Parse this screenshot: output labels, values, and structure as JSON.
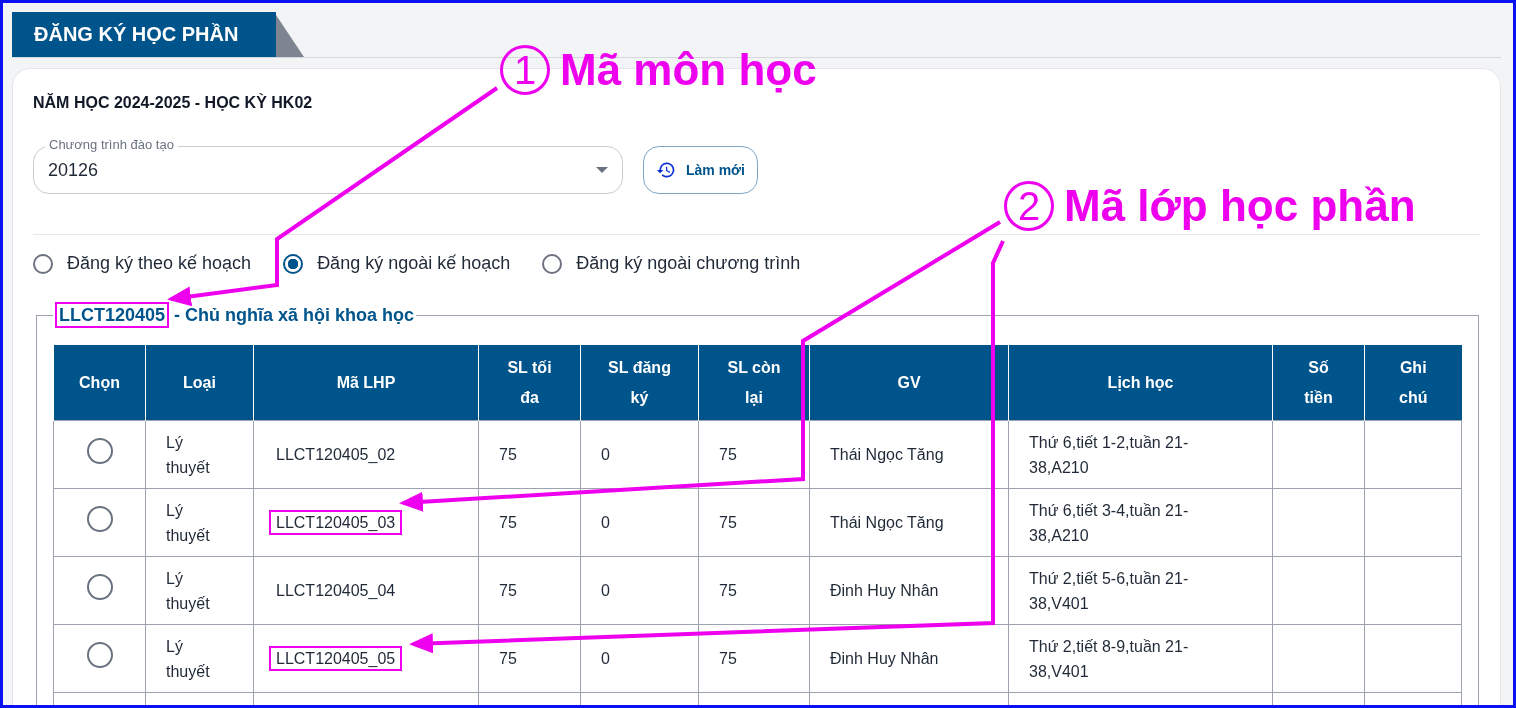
{
  "page_tab": "ĐĂNG KÝ HỌC PHẦN",
  "term_title": "NĂM HỌC 2024-2025 - HỌC KỲ HK02",
  "program_select": {
    "label": "Chương trình đào tạo",
    "value": "20126"
  },
  "refresh_button": "Làm mới",
  "registration_modes": [
    {
      "label": "Đăng ký theo kế hoạch",
      "selected": false
    },
    {
      "label": "Đăng ký ngoài kế hoạch",
      "selected": true
    },
    {
      "label": "Đăng ký ngoài chương trình",
      "selected": false
    }
  ],
  "course": {
    "code": "LLCT120405",
    "highlighted": true,
    "name": "- Chủ nghĩa xã hội khoa học"
  },
  "table": {
    "columns": [
      "Chọn",
      "Loại",
      "Mã LHP",
      "SL tối đa",
      "SL đăng ký",
      "SL còn lại",
      "GV",
      "Lịch học",
      "Số tiền",
      "Ghi chú"
    ],
    "rows": [
      {
        "selected": false,
        "type": "Lý thuyết",
        "class_code": "LLCT120405_02",
        "highlighted": false,
        "max": "75",
        "registered": "0",
        "remaining": "75",
        "lecturer": "Thái Ngọc Tăng",
        "schedule": "Thứ 6,tiết 1-2,tuần 21-38,A210"
      },
      {
        "selected": false,
        "type": "Lý thuyết",
        "class_code": "LLCT120405_03",
        "highlighted": true,
        "max": "75",
        "registered": "0",
        "remaining": "75",
        "lecturer": "Thái Ngọc Tăng",
        "schedule": "Thứ 6,tiết 3-4,tuần 21-38,A210"
      },
      {
        "selected": false,
        "type": "Lý thuyết",
        "class_code": "LLCT120405_04",
        "highlighted": false,
        "max": "75",
        "registered": "0",
        "remaining": "75",
        "lecturer": "Đinh Huy Nhân",
        "schedule": "Thứ 2,tiết 5-6,tuần 21-38,V401"
      },
      {
        "selected": false,
        "type": "Lý thuyết",
        "class_code": "LLCT120405_05",
        "highlighted": true,
        "max": "75",
        "registered": "0",
        "remaining": "75",
        "lecturer": "Đinh Huy Nhân",
        "schedule": "Thứ 2,tiết 8-9,tuần 21-38,V401"
      }
    ]
  },
  "annotations": [
    {
      "number": "1",
      "label": "Mã môn học"
    },
    {
      "number": "2",
      "label": "Mã lớp học phần"
    }
  ]
}
